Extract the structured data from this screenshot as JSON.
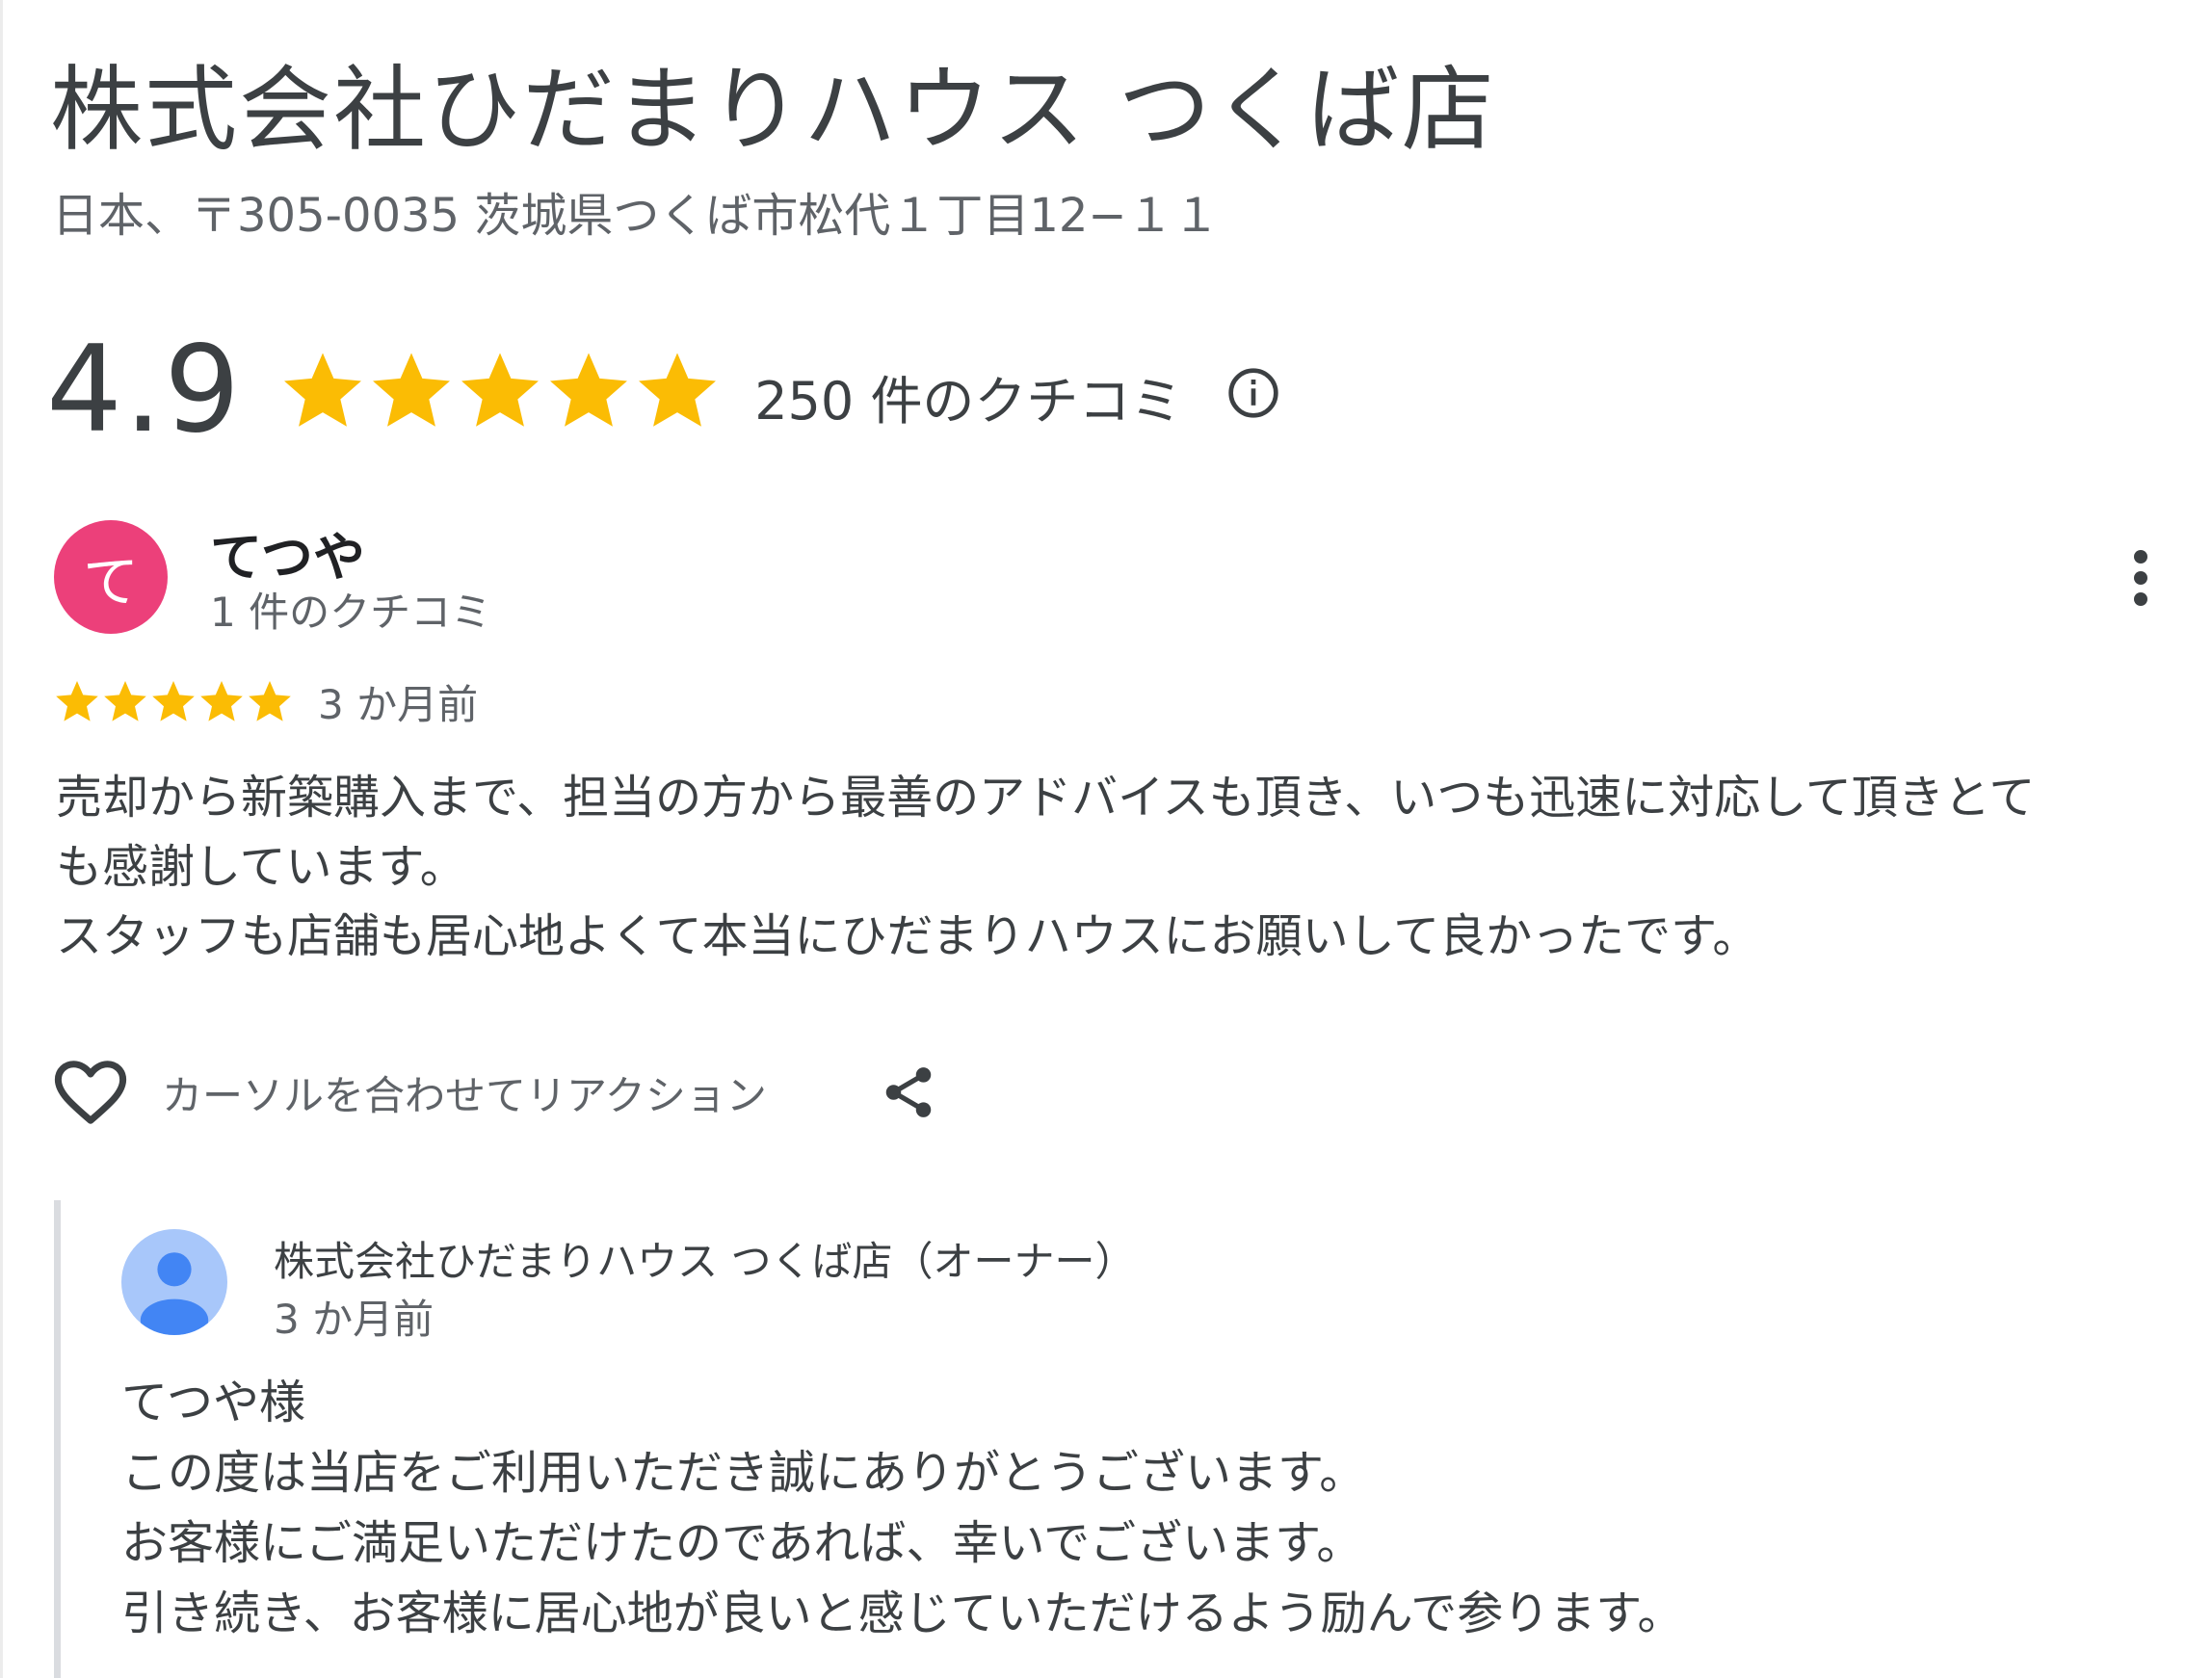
{
  "place": {
    "name": "株式会社ひだまりハウス つくば店",
    "address": "日本、〒305-0035 茨城県つくば市松代１丁目12−１１",
    "rating": "4.9",
    "stars": 5,
    "review_count_label": "250 件のクチコミ",
    "info_icon": "info-circle-icon",
    "star_color": "#fbbc04"
  },
  "review": {
    "avatar_letter": "て",
    "avatar_color": "#ec407a",
    "author": "てつや",
    "author_reviews": "1 件のクチコミ",
    "stars": 5,
    "date": "3 か月前",
    "text_lines": [
      "売却から新築購入まで、担当の方から最善のアドバイスも頂き、いつも迅速に対応して頂きとて",
      "も感謝しています。",
      "スタッフも店舗も居心地よくて本当にひだまりハウスにお願いして良かったです。"
    ],
    "reaction_label": "カーソルを合わせてリアクション",
    "more_icon": "more-vert-icon",
    "heart_icon": "heart-icon",
    "share_icon": "share-icon"
  },
  "owner_reply": {
    "name": "株式会社ひだまりハウス つくば店（オーナー）",
    "date": "3 か月前",
    "avatar_icon": "person-icon",
    "avatar_color": "#a8c7fa",
    "text_lines": [
      "てつや様",
      "この度は当店をご利用いただき誠にありがとうございます。",
      "お客様にご満足いただけたのであれば、幸いでございます。",
      "引き続き、お客様に居心地が良いと感じていただけるよう励んで参ります。"
    ]
  }
}
